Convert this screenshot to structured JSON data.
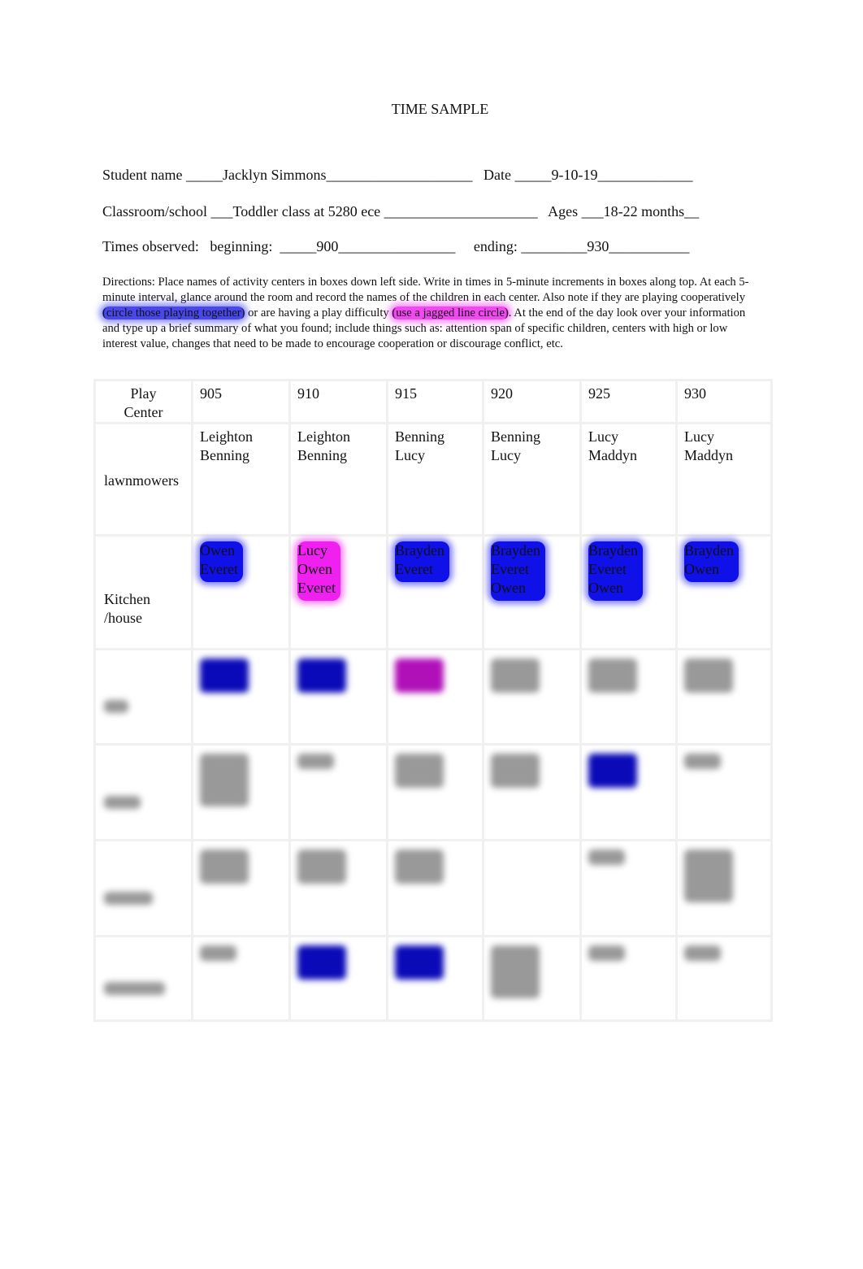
{
  "title": "TIME SAMPLE",
  "fields": {
    "student_line": "Student name _____Jacklyn Simmons____________________   Date _____9-10-19_____________",
    "classroom_line": "Classroom/school ___Toddler class at 5280 ece _____________________   Ages ___18-22 months__",
    "times_line": "Times observed:   beginning:  _____900________________     ending: _________930___________"
  },
  "directions": {
    "part1": "Directions:  Place names of activity centers in boxes down left side.   Write in times in 5-minute increments in boxes along top.   At each 5-minute interval, glance around the room and record the names of the children in each center.      Also note if they are playing cooperatively ",
    "highlight_blue": "(circle those playing together)",
    "part2": " or are having a play difficulty ",
    "highlight_magenta": "(use a jagged line circle)",
    "part3": ".  At the end of the day look over your information and type up a brief summary of what you found; include things such as:    attention span of specific children, centers with high or low interest value, changes that need to be made to encourage cooperation or discourage conflict, etc."
  },
  "colors": {
    "cooperative": "#1010e8",
    "difficulty": "#f020f0"
  },
  "table": {
    "header_label": "Play Center",
    "times": [
      "905",
      "910",
      "915",
      "920",
      "925",
      "930"
    ],
    "rows": [
      {
        "center": "lawnmowers",
        "cells": [
          {
            "names": [
              "Leighton",
              "Benning"
            ],
            "mark": "none"
          },
          {
            "names": [
              "Leighton",
              "Benning"
            ],
            "mark": "none"
          },
          {
            "names": [
              "Benning",
              "Lucy"
            ],
            "mark": "none"
          },
          {
            "names": [
              "Benning",
              "Lucy"
            ],
            "mark": "none"
          },
          {
            "names": [
              "Lucy",
              "Maddyn"
            ],
            "mark": "none"
          },
          {
            "names": [
              "Lucy",
              "Maddyn"
            ],
            "mark": "none"
          }
        ]
      },
      {
        "center": "Kitchen /house",
        "cells": [
          {
            "names": [
              "Owen",
              "Everet"
            ],
            "mark": "blue"
          },
          {
            "names": [
              "Lucy",
              "Owen",
              "Everet"
            ],
            "mark": "magenta"
          },
          {
            "names": [
              "Brayden",
              "Everet"
            ],
            "mark": "blue"
          },
          {
            "names": [
              "Brayden",
              "Everet",
              "Owen"
            ],
            "mark": "blue"
          },
          {
            "names": [
              "Brayden",
              "Everet",
              "Owen"
            ],
            "mark": "blue"
          },
          {
            "names": [
              "Brayden",
              "Owen"
            ],
            "mark": "blue"
          }
        ]
      }
    ],
    "blurred_rows": [
      {
        "label_lines": 1,
        "cells": [
          {
            "mark": "blue",
            "lines": 2
          },
          {
            "mark": "blue",
            "lines": 2
          },
          {
            "mark": "magenta",
            "lines": 2
          },
          {
            "mark": "text",
            "lines": 2
          },
          {
            "mark": "text",
            "lines": 2
          },
          {
            "mark": "text",
            "lines": 2
          }
        ]
      },
      {
        "label_lines": 1,
        "cells": [
          {
            "mark": "text",
            "lines": 3
          },
          {
            "mark": "text",
            "lines": 1
          },
          {
            "mark": "text",
            "lines": 2
          },
          {
            "mark": "text",
            "lines": 2
          },
          {
            "mark": "blue",
            "lines": 2
          },
          {
            "mark": "text",
            "lines": 1
          }
        ]
      },
      {
        "label_lines": 1,
        "cells": [
          {
            "mark": "text",
            "lines": 2
          },
          {
            "mark": "text",
            "lines": 2
          },
          {
            "mark": "text",
            "lines": 2
          },
          {
            "mark": "none",
            "lines": 0
          },
          {
            "mark": "text",
            "lines": 1
          },
          {
            "mark": "text",
            "lines": 3
          }
        ]
      },
      {
        "label_lines": 1,
        "cells": [
          {
            "mark": "text",
            "lines": 1
          },
          {
            "mark": "blue",
            "lines": 2
          },
          {
            "mark": "blue",
            "lines": 2
          },
          {
            "mark": "text",
            "lines": 3
          },
          {
            "mark": "text",
            "lines": 1
          },
          {
            "mark": "text",
            "lines": 1
          }
        ]
      }
    ]
  }
}
